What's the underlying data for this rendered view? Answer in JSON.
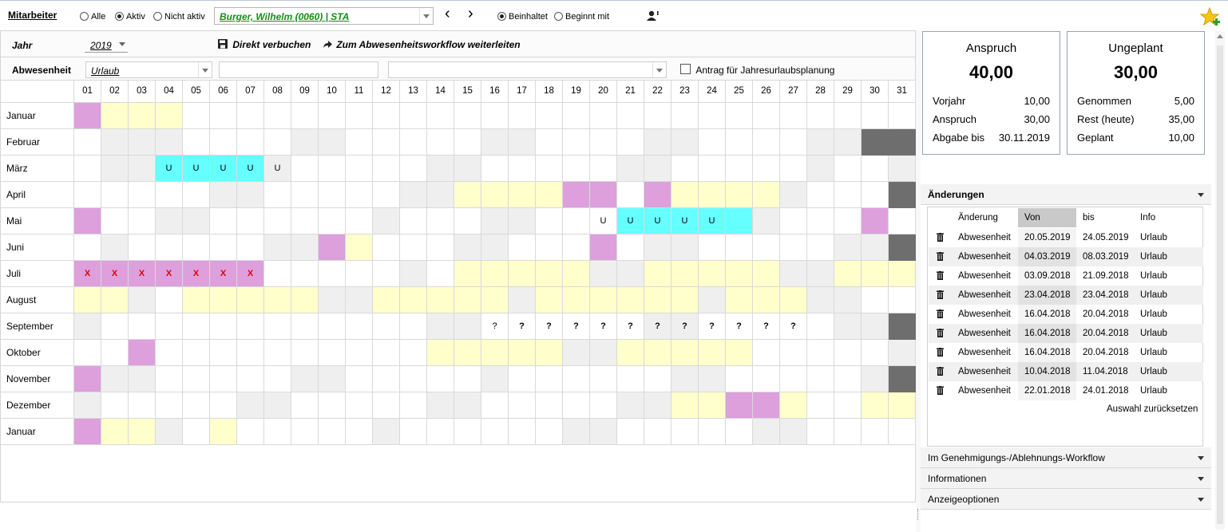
{
  "topbar": {
    "employee_label": "Mitarbeiter",
    "filter_options": [
      {
        "label": "Alle",
        "selected": false
      },
      {
        "label": "Aktiv",
        "selected": true
      },
      {
        "label": "Nicht aktiv",
        "selected": false
      }
    ],
    "employee_value": "Burger, Wilhelm (0060) | STA",
    "employee_value_color": "#1a8a1a",
    "search_mode": [
      {
        "label": "Beinhaltet",
        "selected": true
      },
      {
        "label": "Beginnt mit",
        "selected": false
      }
    ],
    "nav_prev": "‹",
    "nav_next": "›"
  },
  "toolbar": {
    "year_label": "Jahr",
    "year_value": "2019",
    "book_direct": "Direkt verbuchen",
    "forward_workflow": "Zum Abwesenheitsworkflow weiterleiten",
    "absence_label": "Abwesenheit",
    "absence_value": "Urlaub",
    "annual_plan_checkbox": "Antrag für Jahresurlaubsplanung"
  },
  "calendar": {
    "days": [
      "01",
      "02",
      "03",
      "04",
      "05",
      "06",
      "07",
      "08",
      "09",
      "10",
      "11",
      "12",
      "13",
      "14",
      "15",
      "16",
      "17",
      "18",
      "19",
      "20",
      "21",
      "22",
      "23",
      "24",
      "25",
      "26",
      "27",
      "28",
      "29",
      "30",
      "31"
    ],
    "legend_colors": {
      "w": "#ffffff",
      "g": "#efefef",
      "y": "#ffffcc",
      "p": "#dda0dd",
      "c": "#66ffff",
      "d": "#6e6e6e"
    },
    "months": [
      {
        "name": "Januar",
        "cells": "pyyywwwwwwwwwwwwwwwwwwwwwwwwwww",
        "marks": {}
      },
      {
        "name": "Februar",
        "cells": "wgggwwwwggwwwwwggwwwwggwwwwggdd",
        "marks": {}
      },
      {
        "name": "März",
        "cells": "wggccccgwwwwwggwwwwwggwwwwwgwwg",
        "marks": {
          "04": "U",
          "05": "U",
          "06": "U",
          "07": "U",
          "08": "U"
        }
      },
      {
        "name": "April",
        "cells": "wwwwwggwwwwwggyyyyppwpyyyygwwwd",
        "marks": {}
      },
      {
        "name": "Mai",
        "cells": "pwwggwwwwwwgwwwggwwwcccccgwwwpw",
        "marks": {
          "20": "U",
          "21": "U",
          "22": "U",
          "23": "U",
          "24": "U"
        }
      },
      {
        "name": "Juni",
        "cells": "wgwwwwwggpywwwggwwwpwggwwwwwggd",
        "marks": {}
      },
      {
        "name": "Juli",
        "cells": "pppppppwwwwwgwyyyyyggyyyyyggyyy",
        "marks": {
          "01": "X",
          "02": "X",
          "03": "X",
          "04": "X",
          "05": "X",
          "06": "X",
          "07": "X"
        }
      },
      {
        "name": "August",
        "cells": "yygwyyyyyggyyyyygyyyyyygyyyggww",
        "marks": {}
      },
      {
        "name": "September",
        "cells": "gwwwwwwwwwwwwggwwwwwwggwwwwwggd",
        "marks": {
          "16": "?",
          "17": "?",
          "18": "?",
          "19": "?",
          "20": "?",
          "21": "?",
          "22": "?",
          "23": "?",
          "24": "?",
          "25": "?",
          "26": "?",
          "27": "?"
        }
      },
      {
        "name": "Oktober",
        "cells": "wwpwwwwwwwwwwyyyyyggyyyyywwwwwg",
        "marks": {}
      },
      {
        "name": "November",
        "cells": "pggwwwwwggwwwwwgwwwwwwggwwwwwgd",
        "marks": {}
      },
      {
        "name": "Dezember",
        "cells": "gwwwwwggwwwwwggwwwwwggyyppywwyy",
        "marks": {}
      },
      {
        "name": "Januar",
        "cells": "pyygwywwwwwgwwwwwwggwwwwwggwwww",
        "marks": {}
      }
    ]
  },
  "summary": {
    "entitlement": {
      "title": "Anspruch",
      "value": "40,00",
      "rows": [
        {
          "k": "Vorjahr",
          "v": "10,00"
        },
        {
          "k": "Anspruch",
          "v": "30,00"
        },
        {
          "k": "Abgabe bis",
          "v": "30.11.2019"
        }
      ]
    },
    "unplanned": {
      "title": "Ungeplant",
      "value": "30,00",
      "rows": [
        {
          "k": "Genommen",
          "v": "5,00"
        },
        {
          "k": "Rest (heute)",
          "v": "35,00"
        },
        {
          "k": "Geplant",
          "v": "10,00"
        }
      ]
    }
  },
  "changes": {
    "title": "Änderungen",
    "columns": [
      "Änderung",
      "Von",
      "bis",
      "Info"
    ],
    "rows": [
      {
        "type": "Abwesenheit",
        "from": "20.05.2019",
        "to": "24.05.2019",
        "info": "Urlaub"
      },
      {
        "type": "Abwesenheit",
        "from": "04.03.2019",
        "to": "08.03.2019",
        "info": "Urlaub"
      },
      {
        "type": "Abwesenheit",
        "from": "03.09.2018",
        "to": "21.09.2018",
        "info": "Urlaub"
      },
      {
        "type": "Abwesenheit",
        "from": "23.04.2018",
        "to": "23.04.2018",
        "info": "Urlaub"
      },
      {
        "type": "Abwesenheit",
        "from": "16.04.2018",
        "to": "20.04.2018",
        "info": "Urlaub"
      },
      {
        "type": "Abwesenheit",
        "from": "16.04.2018",
        "to": "20.04.2018",
        "info": "Urlaub"
      },
      {
        "type": "Abwesenheit",
        "from": "16.04.2018",
        "to": "20.04.2018",
        "info": "Urlaub"
      },
      {
        "type": "Abwesenheit",
        "from": "10.04.2018",
        "to": "11.04.2018",
        "info": "Urlaub"
      },
      {
        "type": "Abwesenheit",
        "from": "22.01.2018",
        "to": "24.01.2018",
        "info": "Urlaub"
      }
    ],
    "reset": "Auswahl zurücksetzen"
  },
  "sections": [
    "Im Genehmigungs-/Ablehnungs-Workflow",
    "Informationen",
    "Anzeigeoptionen"
  ]
}
